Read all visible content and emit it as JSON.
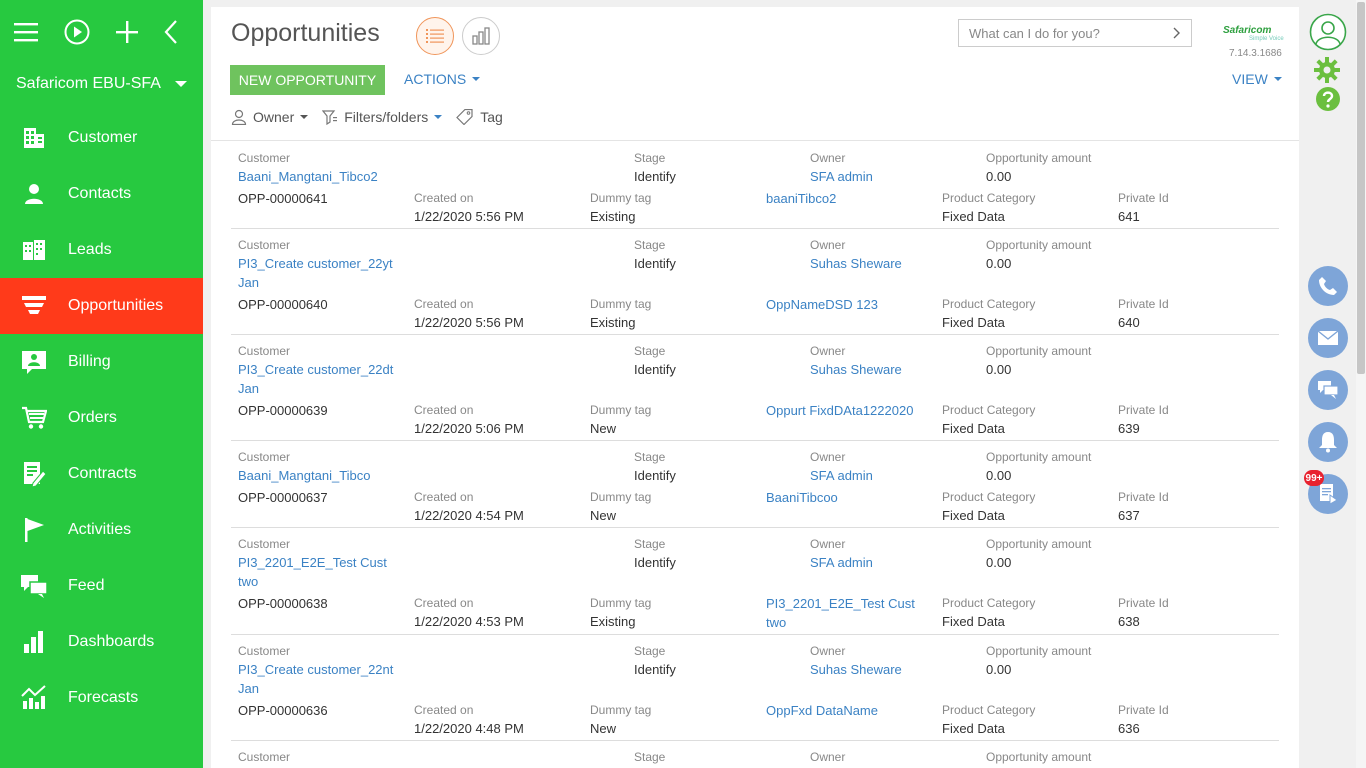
{
  "workspace": "Safaricom EBU-SFA",
  "sidebar": {
    "items": [
      {
        "label": "Customer",
        "icon": "building-icon"
      },
      {
        "label": "Contacts",
        "icon": "person-icon"
      },
      {
        "label": "Leads",
        "icon": "leads-icon"
      },
      {
        "label": "Opportunities",
        "icon": "funnel-icon",
        "active": true
      },
      {
        "label": "Billing",
        "icon": "billing-icon"
      },
      {
        "label": "Orders",
        "icon": "cart-icon"
      },
      {
        "label": "Contracts",
        "icon": "contract-icon"
      },
      {
        "label": "Activities",
        "icon": "flag-icon"
      },
      {
        "label": "Feed",
        "icon": "chat-icon"
      },
      {
        "label": "Dashboards",
        "icon": "bars-icon"
      },
      {
        "label": "Forecasts",
        "icon": "forecast-icon"
      }
    ]
  },
  "header": {
    "title": "Opportunities",
    "search_placeholder": "What can I do for you?",
    "logo_text": "Safaricom",
    "logo_sub": "Simple Voice",
    "version": "7.14.3.1686"
  },
  "toolbar": {
    "new_label": "NEW OPPORTUNITY",
    "actions_label": "ACTIONS",
    "view_label": "VIEW"
  },
  "filters": {
    "owner": "Owner",
    "folders": "Filters/folders",
    "tag": "Tag"
  },
  "labels": {
    "customer": "Customer",
    "stage": "Stage",
    "owner": "Owner",
    "amount": "Opportunity amount",
    "created": "Created on",
    "dummy": "Dummy tag",
    "category": "Product Category",
    "private": "Private Id"
  },
  "records": [
    {
      "customer": "Baani_Mangtani_Tibco2",
      "stage": "Identify",
      "owner": "SFA admin",
      "amount": "0.00",
      "number": "OPP-00000641",
      "created": "1/22/2020 5:56 PM",
      "dummy": "Existing",
      "name": "baaniTibco2",
      "category": "Fixed Data",
      "private_id": "641"
    },
    {
      "customer": "PI3_Create customer_22yt Jan",
      "stage": "Identify",
      "owner": "Suhas Sheware",
      "amount": "0.00",
      "number": "OPP-00000640",
      "created": "1/22/2020 5:56 PM",
      "dummy": "Existing",
      "name": "OppNameDSD 123",
      "category": "Fixed Data",
      "private_id": "640"
    },
    {
      "customer": "PI3_Create customer_22dt Jan",
      "stage": "Identify",
      "owner": "Suhas Sheware",
      "amount": "0.00",
      "number": "OPP-00000639",
      "created": "1/22/2020 5:06 PM",
      "dummy": "New",
      "name": "Oppurt FixdDAta1222020",
      "category": "Fixed Data",
      "private_id": "639"
    },
    {
      "customer": "Baani_Mangtani_Tibco",
      "stage": "Identify",
      "owner": "SFA admin",
      "amount": "0.00",
      "number": "OPP-00000637",
      "created": "1/22/2020 4:54 PM",
      "dummy": "New",
      "name": "BaaniTibcoo",
      "category": "Fixed Data",
      "private_id": "637"
    },
    {
      "customer": "PI3_2201_E2E_Test Cust two",
      "stage": "Identify",
      "owner": "SFA admin",
      "amount": "0.00",
      "number": "OPP-00000638",
      "created": "1/22/2020 4:53 PM",
      "dummy": "Existing",
      "name": "PI3_2201_E2E_Test Cust two",
      "category": "Fixed Data",
      "private_id": "638"
    },
    {
      "customer": "PI3_Create customer_22nt Jan",
      "stage": "Identify",
      "owner": "Suhas Sheware",
      "amount": "0.00",
      "number": "OPP-00000636",
      "created": "1/22/2020 4:48 PM",
      "dummy": "New",
      "name": "OppFxd DataName",
      "category": "Fixed Data",
      "private_id": "636"
    }
  ],
  "partial_record": {
    "customer": "Customer",
    "stage": "Stage",
    "owner": "Owner",
    "amount": "Opportunity amount"
  },
  "notifications_badge": "99+",
  "colors": {
    "sidebar": "#27c940",
    "active": "#ff3a1a",
    "link": "#3b82c4",
    "primary_button": "#6fc35e",
    "right_icons": "#7ea5d8"
  }
}
